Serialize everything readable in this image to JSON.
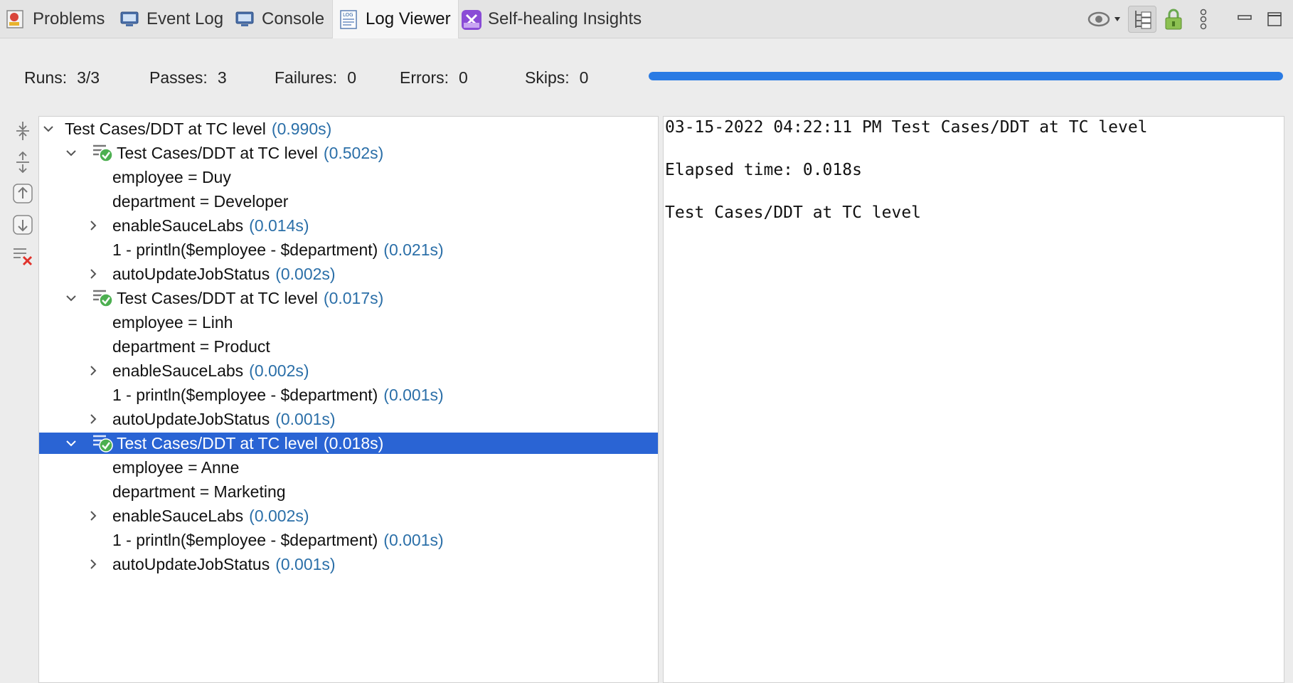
{
  "tabs": [
    {
      "label": "Problems",
      "icon": "problems-icon"
    },
    {
      "label": "Event Log",
      "icon": "event-log-icon"
    },
    {
      "label": "Console",
      "icon": "console-icon"
    },
    {
      "label": "Log Viewer",
      "icon": "log-viewer-icon",
      "active": true
    },
    {
      "label": "Self-healing Insights",
      "icon": "self-healing-icon"
    }
  ],
  "summary": {
    "runs_label": "Runs:",
    "runs_value": "3/3",
    "passes_label": "Passes:",
    "passes_value": "3",
    "failures_label": "Failures:",
    "failures_value": "0",
    "errors_label": "Errors:",
    "errors_value": "0",
    "skips_label": "Skips:",
    "skips_value": "0",
    "progress": 1.0
  },
  "tree": [
    {
      "text": "Test Cases/DDT at TC level",
      "duration": "(0.990s)",
      "expander": "expanded",
      "status": "none"
    },
    {
      "text": "Test Cases/DDT at TC level",
      "duration": "(0.502s)",
      "expander": "expanded",
      "status": "passed"
    },
    {
      "text": "employee = Duy",
      "duration": "",
      "expander": "none",
      "status": "none"
    },
    {
      "text": "department = Developer",
      "duration": "",
      "expander": "none",
      "status": "none"
    },
    {
      "text": "enableSauceLabs",
      "duration": "(0.014s)",
      "expander": "collapsed",
      "status": "none"
    },
    {
      "text": "1 - println($employee - $department)",
      "duration": "(0.021s)",
      "expander": "none",
      "status": "none"
    },
    {
      "text": "autoUpdateJobStatus",
      "duration": "(0.002s)",
      "expander": "collapsed",
      "status": "none"
    },
    {
      "text": "Test Cases/DDT at TC level",
      "duration": "(0.017s)",
      "expander": "expanded",
      "status": "passed"
    },
    {
      "text": "employee = Linh",
      "duration": "",
      "expander": "none",
      "status": "none"
    },
    {
      "text": "department = Product",
      "duration": "",
      "expander": "none",
      "status": "none"
    },
    {
      "text": "enableSauceLabs",
      "duration": "(0.002s)",
      "expander": "collapsed",
      "status": "none"
    },
    {
      "text": "1 - println($employee - $department)",
      "duration": "(0.001s)",
      "expander": "none",
      "status": "none"
    },
    {
      "text": "autoUpdateJobStatus",
      "duration": "(0.001s)",
      "expander": "collapsed",
      "status": "none"
    },
    {
      "text": "Test Cases/DDT at TC level",
      "duration": "(0.018s)",
      "expander": "expanded",
      "status": "passed",
      "selected": true
    },
    {
      "text": "employee = Anne",
      "duration": "",
      "expander": "none",
      "status": "none"
    },
    {
      "text": "department = Marketing",
      "duration": "",
      "expander": "none",
      "status": "none"
    },
    {
      "text": "enableSauceLabs",
      "duration": "(0.002s)",
      "expander": "collapsed",
      "status": "none"
    },
    {
      "text": "1 - println($employee - $department)",
      "duration": "(0.001s)",
      "expander": "none",
      "status": "none"
    },
    {
      "text": "autoUpdateJobStatus",
      "duration": "(0.001s)",
      "expander": "collapsed",
      "status": "none"
    }
  ],
  "log": {
    "line1": "03-15-2022 04:22:11 PM Test Cases/DDT at TC level",
    "line2": "Elapsed time: 0.018s",
    "line3": "Test Cases/DDT at TC level"
  },
  "colors": {
    "accent": "#2a7be4",
    "selection": "#2a64d4",
    "duration": "#2b6fa8",
    "pass": "#4caf50"
  }
}
